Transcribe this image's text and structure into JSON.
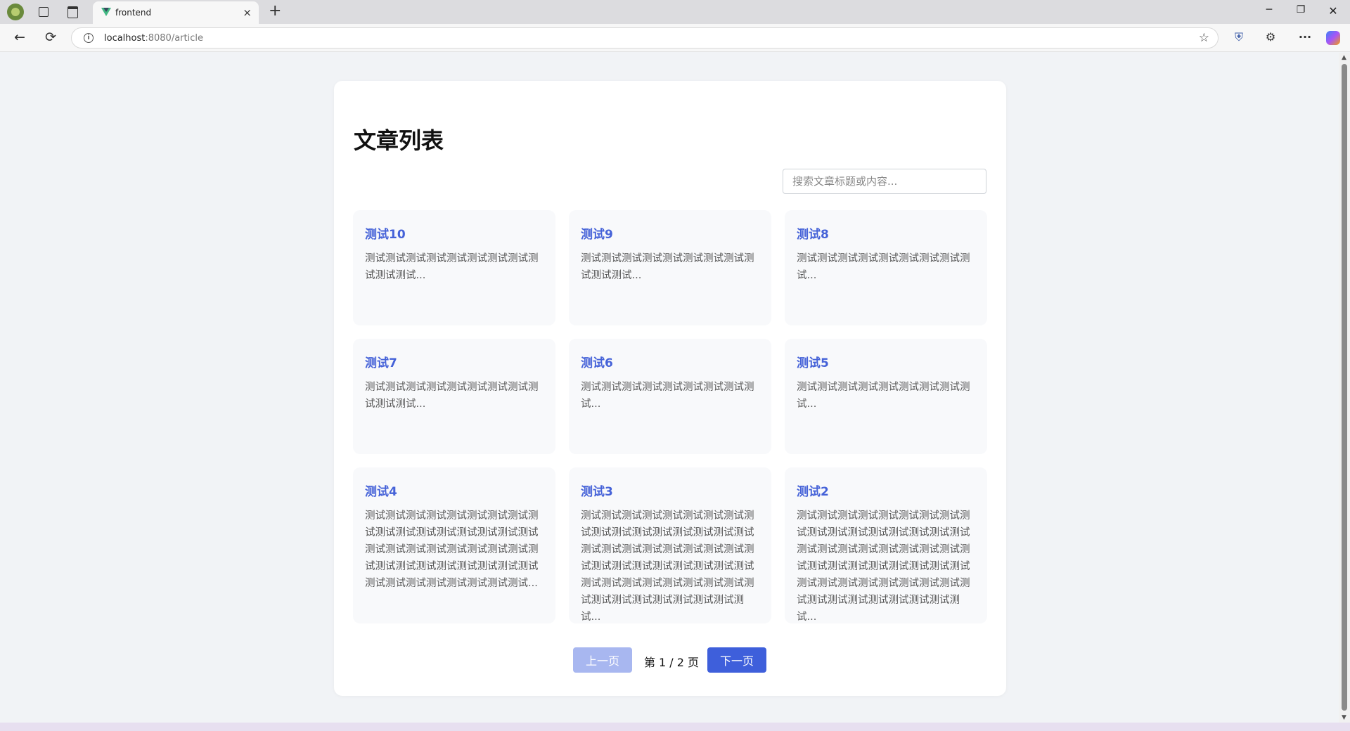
{
  "browser": {
    "tab_title": "frontend",
    "url_host": "localhost",
    "url_rest": ":8080/article",
    "icons": {
      "close": "×",
      "new_tab": "+",
      "back": "←",
      "reload": "⟳",
      "minimize": "─",
      "maximize": "❐",
      "window_close": "✕",
      "star": "☆",
      "shield": "⛨",
      "extensions": "⚙",
      "more": "···",
      "info": "i"
    }
  },
  "page": {
    "title": "文章列表",
    "search_placeholder": "搜索文章标题或内容..."
  },
  "articles": [
    {
      "title": "测试10",
      "excerpt": "测试测试测试测试测试测试测试测试测试测试测试..."
    },
    {
      "title": "测试9",
      "excerpt": "测试测试测试测试测试测试测试测试测试测试测试..."
    },
    {
      "title": "测试8",
      "excerpt": "测试测试测试测试测试测试测试测试测试..."
    },
    {
      "title": "测试7",
      "excerpt": "测试测试测试测试测试测试测试测试测试测试测试..."
    },
    {
      "title": "测试6",
      "excerpt": "测试测试测试测试测试测试测试测试测试..."
    },
    {
      "title": "测试5",
      "excerpt": "测试测试测试测试测试测试测试测试测试..."
    },
    {
      "title": "测试4",
      "excerpt": "测试测试测试测试测试测试测试测试测试测试测试测试测试测试测试测试测试测试测试测试测试测试测试测试测试测试测试测试测试测试测试测试测试测试测试测试测试测试测试测试测试测试..."
    },
    {
      "title": "测试3",
      "excerpt": "测试测试测试测试测试测试测试测试测试测试测试测试测试测试测试测试测试测试测试测试测试测试测试测试测试测试测试测试测试测试测试测试测试测试测试测试测试测试测试测试测试测试测试测试测试测试测试测试测试测试测试..."
    },
    {
      "title": "测试2",
      "excerpt": "测试测试测试测试测试测试测试测试测试测试测试测试测试测试测试测试测试测试测试测试测试测试测试测试测试测试测试测试测试测试测试测试测试测试测试测试测试测试测试测试测试测试测试测试测试测试测试测试测试测试测试..."
    }
  ],
  "pagination": {
    "prev_label": "上一页",
    "next_label": "下一页",
    "info": "第 1 / 2 页"
  }
}
